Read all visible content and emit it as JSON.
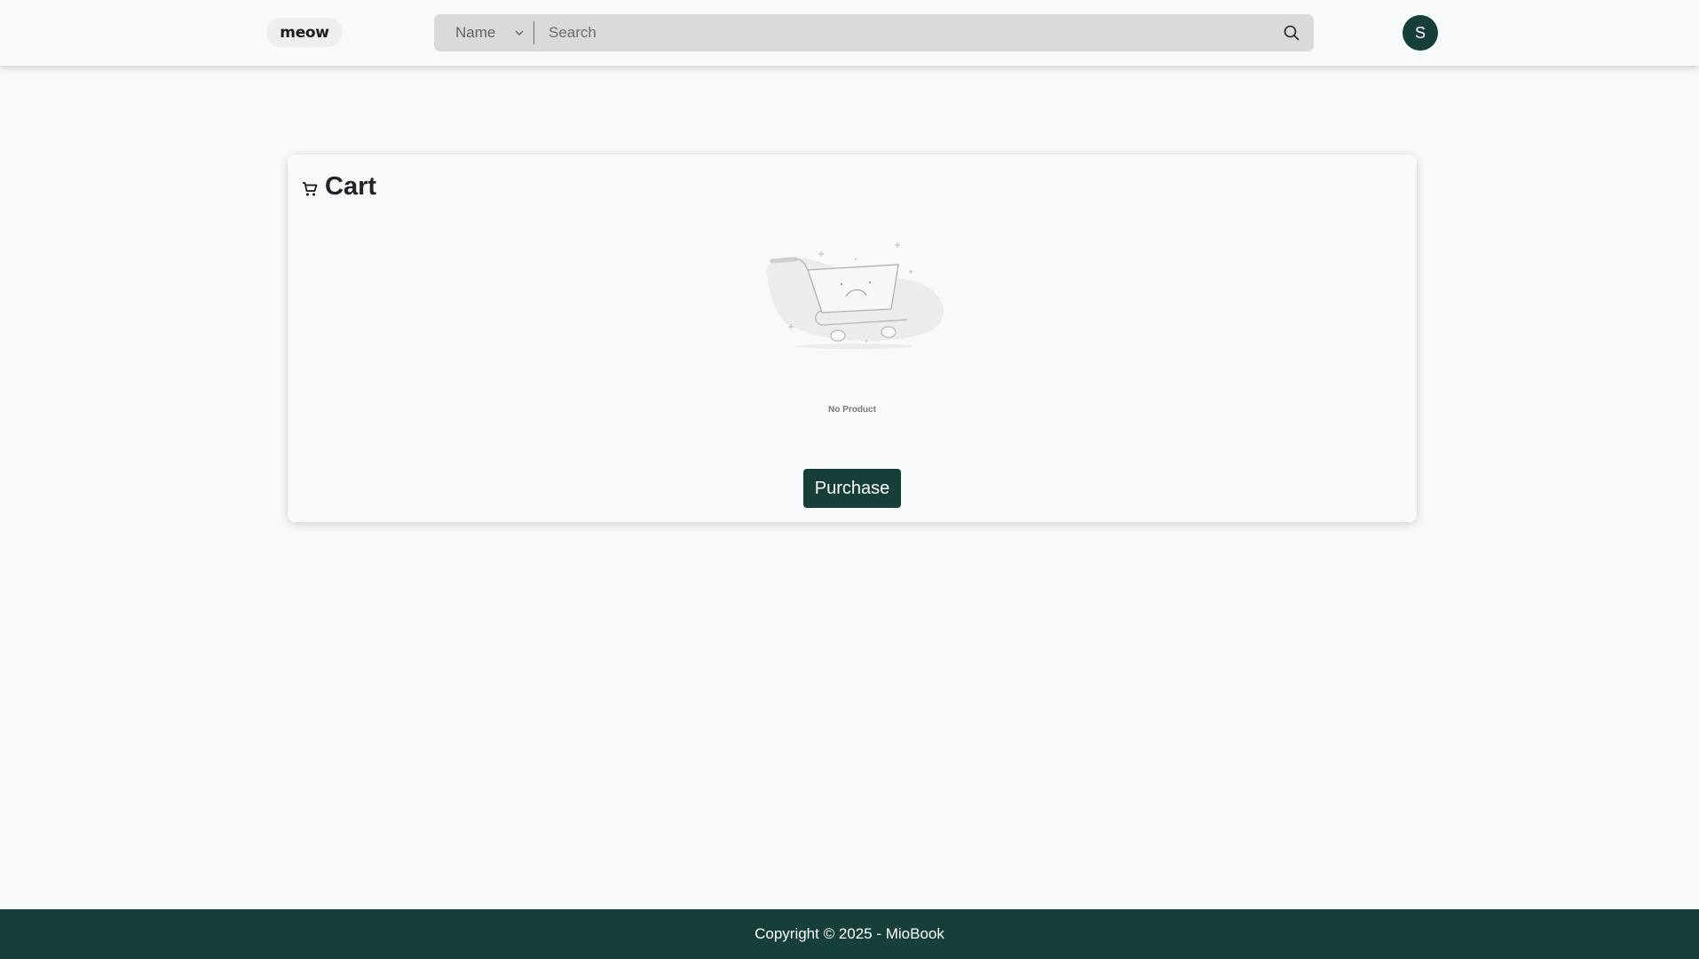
{
  "header": {
    "logo_text": "meow",
    "search": {
      "filter_selected": "Name",
      "placeholder": "Search",
      "value": ""
    },
    "user_initial": "S"
  },
  "cart": {
    "title": "Cart",
    "empty_message": "No Product",
    "purchase_label": "Purchase"
  },
  "footer": {
    "copyright": "Copyright © 2025 - MioBook"
  },
  "colors": {
    "brand": "#173f3a",
    "background": "#f8f9fa",
    "search_bg": "#dadada"
  },
  "icons": {
    "search": "search-icon",
    "dropdown": "chevron-down-icon",
    "cart": "cart-icon",
    "empty_cart": "empty-cart-illustration"
  }
}
